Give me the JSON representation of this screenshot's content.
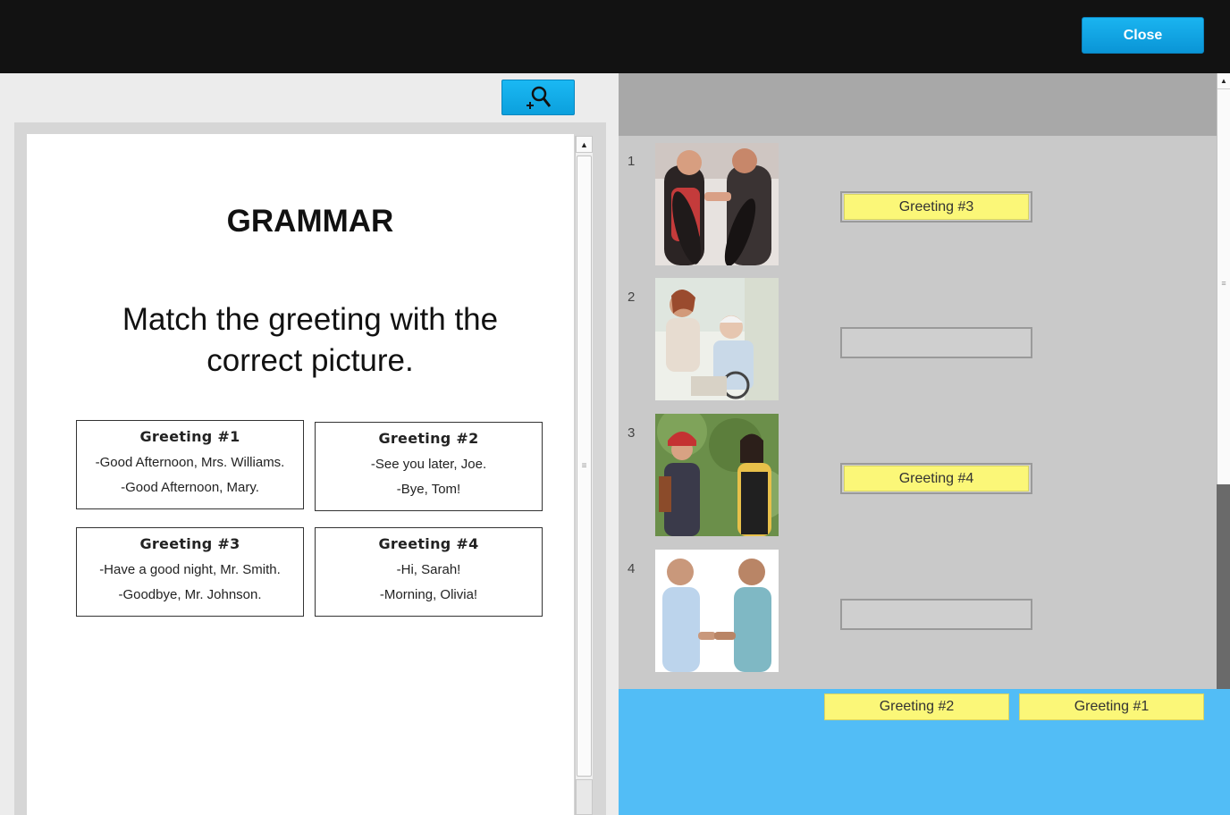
{
  "topbar": {
    "close_label": "Close"
  },
  "left": {
    "title": "GRAMMAR",
    "instructions": "Match the greeting with the correct picture.",
    "greetings": [
      {
        "title": "Greeting #1",
        "line1": "-Good Afternoon, Mrs. Williams.",
        "line2": "-Good Afternoon, Mary."
      },
      {
        "title": "Greeting #2",
        "line1": "-See you later, Joe.",
        "line2": "-Bye, Tom!"
      },
      {
        "title": "Greeting #3",
        "line1": "-Have a good night, Mr. Smith.",
        "line2": "-Goodbye, Mr. Johnson."
      },
      {
        "title": "Greeting #4",
        "line1": "-Hi, Sarah!",
        "line2": "-Morning, Olivia!"
      }
    ]
  },
  "right": {
    "rows": [
      {
        "number": "1",
        "photo": "two teens with skateboards",
        "answer": "Greeting #3"
      },
      {
        "number": "2",
        "photo": "woman greeting elderly man in wheelchair",
        "answer": ""
      },
      {
        "number": "3",
        "photo": "two young women with backpacks waving",
        "answer": "Greeting #4"
      },
      {
        "number": "4",
        "photo": "two men shaking hands",
        "answer": ""
      }
    ],
    "bank": [
      "Greeting #2",
      "Greeting #1"
    ]
  },
  "colors": {
    "accent": "#0ca0dd",
    "chip": "#fbf778",
    "bank": "#52bdf6",
    "topbar": "#121212"
  },
  "icons": {
    "zoom": "zoom-in-icon"
  }
}
